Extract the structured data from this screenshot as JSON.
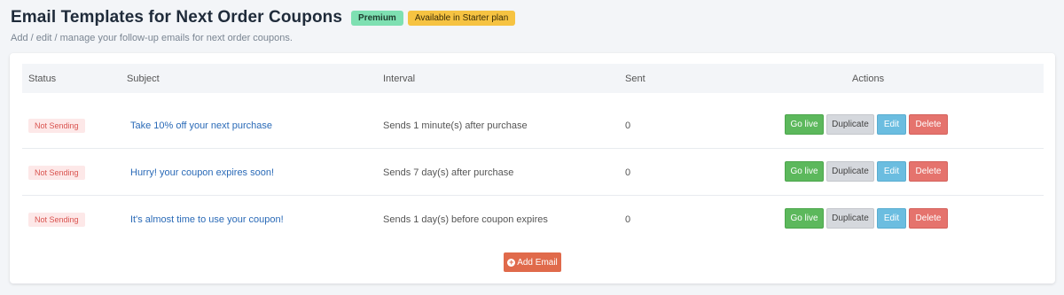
{
  "header": {
    "title": "Email Templates for Next Order Coupons",
    "badge_premium": "Premium",
    "badge_plan": "Available in Starter plan",
    "subtitle": "Add / edit / manage your follow-up emails for next order coupons."
  },
  "table": {
    "columns": {
      "status": "Status",
      "subject": "Subject",
      "interval": "Interval",
      "sent": "Sent",
      "actions": "Actions"
    },
    "rows": [
      {
        "status": "Not Sending",
        "subject": "Take 10% off your next purchase",
        "interval": "Sends 1 minute(s) after purchase",
        "sent": "0"
      },
      {
        "status": "Not Sending",
        "subject": "Hurry! your coupon expires soon!",
        "interval": "Sends 7 day(s) after purchase",
        "sent": "0"
      },
      {
        "status": "Not Sending",
        "subject": "It's almost time to use your coupon!",
        "interval": "Sends 1 day(s) before coupon expires",
        "sent": "0"
      }
    ],
    "actions": {
      "go_live": "Go live",
      "duplicate": "Duplicate",
      "edit": "Edit",
      "delete": "Delete"
    }
  },
  "add_email_label": "Add Email",
  "colors": {
    "go_live": "#5cb85c",
    "duplicate": "#d5d8dd",
    "edit": "#6bbde0",
    "delete": "#e5736d",
    "add_email": "#e06a4b",
    "premium_badge": "#7ee0b2",
    "plan_badge": "#f6c342",
    "link": "#2a6ab7"
  },
  "icons": {
    "add_email": "plus-circle-icon"
  }
}
